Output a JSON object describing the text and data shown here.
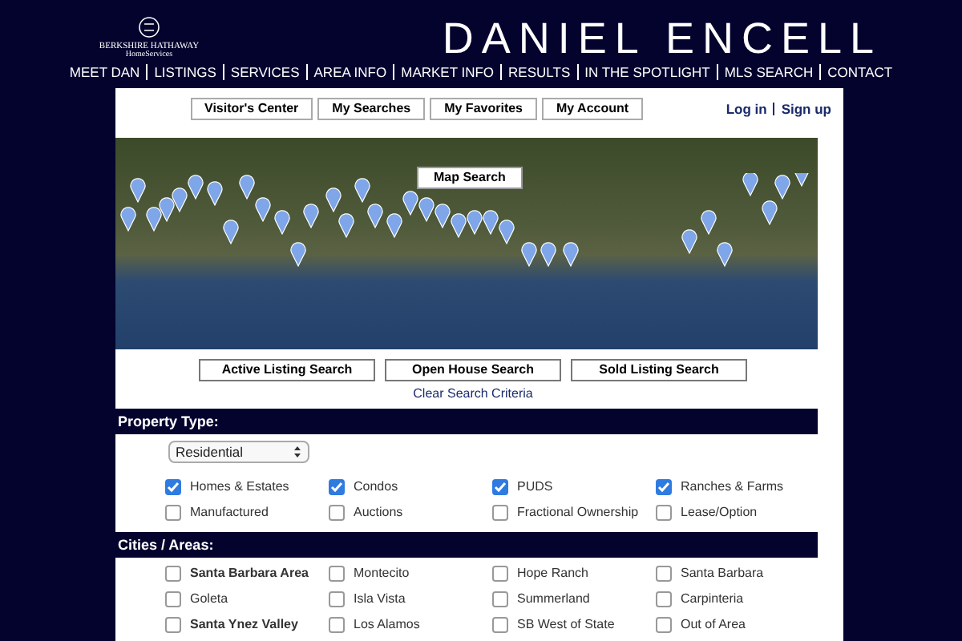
{
  "header": {
    "logo": {
      "line_1": "BERKSHIRE HATHAWAY",
      "line_2": "HomeServices"
    },
    "title": "DANIEL ENCELL"
  },
  "nav": [
    "MEET DAN",
    "LISTINGS",
    "SERVICES",
    "AREA INFO",
    "MARKET INFO",
    "RESULTS",
    "IN THE SPOTLIGHT",
    "MLS SEARCH",
    "CONTACT"
  ],
  "account_tabs": [
    "Visitor's Center",
    "My Searches",
    "My Favorites",
    "My Account"
  ],
  "auth_links": [
    "Log in",
    "Sign up"
  ],
  "map": {
    "button": "Map Search"
  },
  "search_buttons": [
    "Active Listing Search",
    "Open House Search",
    "Sold Listing Search"
  ],
  "clear_link": "Clear Search Criteria",
  "property_type": {
    "heading": "Property Type:",
    "select_value": "Residential",
    "options": [
      {
        "label": "Homes & Estates",
        "checked": true
      },
      {
        "label": "Condos",
        "checked": true
      },
      {
        "label": "PUDS",
        "checked": true
      },
      {
        "label": "Ranches & Farms",
        "checked": true
      },
      {
        "label": "Manufactured",
        "checked": false
      },
      {
        "label": "Auctions",
        "checked": false
      },
      {
        "label": "Fractional Ownership",
        "checked": false
      },
      {
        "label": "Lease/Option",
        "checked": false
      }
    ]
  },
  "cities": {
    "heading": "Cities / Areas:",
    "options": [
      {
        "label": "Santa Barbara Area",
        "checked": false,
        "bold": true
      },
      {
        "label": "Montecito",
        "checked": false,
        "bold": false
      },
      {
        "label": "Hope Ranch",
        "checked": false,
        "bold": false
      },
      {
        "label": "Santa Barbara",
        "checked": false,
        "bold": false
      },
      {
        "label": "Goleta",
        "checked": false,
        "bold": false
      },
      {
        "label": "Isla Vista",
        "checked": false,
        "bold": false
      },
      {
        "label": "Summerland",
        "checked": false,
        "bold": false
      },
      {
        "label": "Carpinteria",
        "checked": false,
        "bold": false
      },
      {
        "label": "Santa Ynez Valley",
        "checked": false,
        "bold": true
      },
      {
        "label": "Los Alamos",
        "checked": false,
        "bold": false
      },
      {
        "label": "SB West of State",
        "checked": false,
        "bold": false
      },
      {
        "label": "Out of Area",
        "checked": false,
        "bold": false
      }
    ]
  }
}
